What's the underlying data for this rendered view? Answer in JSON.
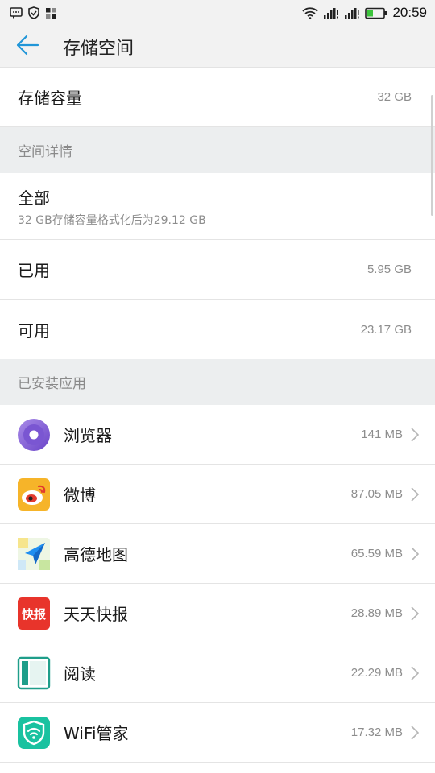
{
  "status_bar": {
    "time": "20:59",
    "left_icons": [
      "message-icon",
      "shield-icon",
      "apps-icon"
    ],
    "right_icons": [
      "wifi-icon",
      "signal-icon",
      "signal-icon",
      "battery-icon"
    ],
    "battery_color": "#3cc43c"
  },
  "header": {
    "title": "存储空间",
    "back_icon": "arrow-left-icon",
    "accent": "#2196d8"
  },
  "storage": {
    "label": "存储容量",
    "value": "32 GB"
  },
  "details": {
    "section_title": "空间详情",
    "total": {
      "label": "全部",
      "sub": "32 GB存储容量格式化后为29.12 GB"
    },
    "used": {
      "label": "已用",
      "value": "5.95 GB"
    },
    "available": {
      "label": "可用",
      "value": "23.17 GB"
    }
  },
  "apps": {
    "section_title": "已安装应用",
    "items": [
      {
        "name": "浏览器",
        "size": "141 MB",
        "icon": "browser-icon"
      },
      {
        "name": "微博",
        "size": "87.05 MB",
        "icon": "weibo-icon"
      },
      {
        "name": "高德地图",
        "size": "65.59 MB",
        "icon": "amap-icon"
      },
      {
        "name": "天天快报",
        "size": "28.89 MB",
        "icon": "kuaibao-icon",
        "icon_text": "快报"
      },
      {
        "name": "阅读",
        "size": "22.29 MB",
        "icon": "reader-icon"
      },
      {
        "name": "WiFi管家",
        "size": "17.32 MB",
        "icon": "wifi-manager-icon"
      }
    ]
  }
}
